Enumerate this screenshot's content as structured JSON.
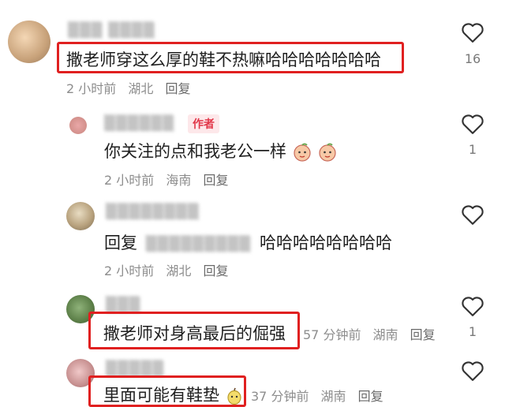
{
  "comments": [
    {
      "username": "▒▒▒ ▒▒▒▒",
      "text": "撒老师穿这么厚的鞋不热嘛哈哈哈哈哈哈哈",
      "time": "2 小时前",
      "location": "湖北",
      "reply": "回复",
      "likes": "16"
    },
    {
      "username": "▒▒▒▒▒▒",
      "author_tag": "作者",
      "text": "你关注的点和我老公一样",
      "time": "2 小时前",
      "location": "海南",
      "reply": "回复",
      "likes": "1"
    },
    {
      "username": "▒▒▒▒▒▒▒▒",
      "reply_prefix": "回复",
      "reply_to": "▒▒▒▒▒▒▒▒▒",
      "text": "哈哈哈哈哈哈哈哈",
      "time": "2 小时前",
      "location": "湖北",
      "reply": "回复",
      "likes": ""
    },
    {
      "username": "▒▒▒",
      "text": "撒老师对身高最后的倔强",
      "time": "57 分钟前",
      "location": "湖南",
      "reply": "回复",
      "likes": "1"
    },
    {
      "username": "▒▒▒▒▒",
      "text": "里面可能有鞋垫",
      "time": "37 分钟前",
      "location": "湖南",
      "reply": "回复",
      "likes": ""
    }
  ],
  "colors": {
    "highlight_box": "#e02020",
    "author_tag_bg": "#fde8ea",
    "author_tag_text": "#e2384a",
    "meta_text": "#8d8d8d"
  }
}
